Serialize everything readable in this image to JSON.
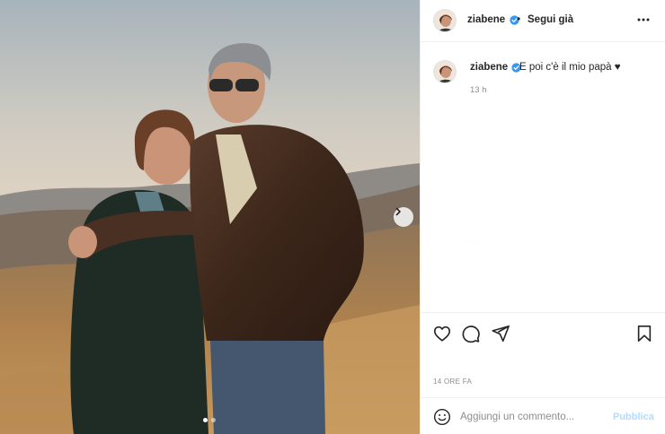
{
  "post": {
    "author": "ziabene",
    "follow_status": "Segui già",
    "separator": "•",
    "caption": "E poi c'è il mio papà ♥",
    "caption_time": "13 h",
    "timestamp": "14 ORE FA",
    "faint_text": "· ·",
    "carousel": {
      "total_slides": 2,
      "active_slide": 1
    }
  },
  "comment": {
    "placeholder": "Aggiungi un commento...",
    "publish_label": "Pubblica"
  },
  "icons": {
    "verified": "verified-badge-icon",
    "more": "more-horizontal-icon",
    "like": "heart-icon",
    "comment": "comment-bubble-icon",
    "share": "paper-plane-icon",
    "save": "bookmark-icon",
    "emoji": "smiley-icon",
    "next": "chevron-right-icon"
  },
  "colors": {
    "verified_blue": "#3897f0",
    "publish_disabled": "#b3dbff",
    "muted_text": "#8e8e8e"
  }
}
